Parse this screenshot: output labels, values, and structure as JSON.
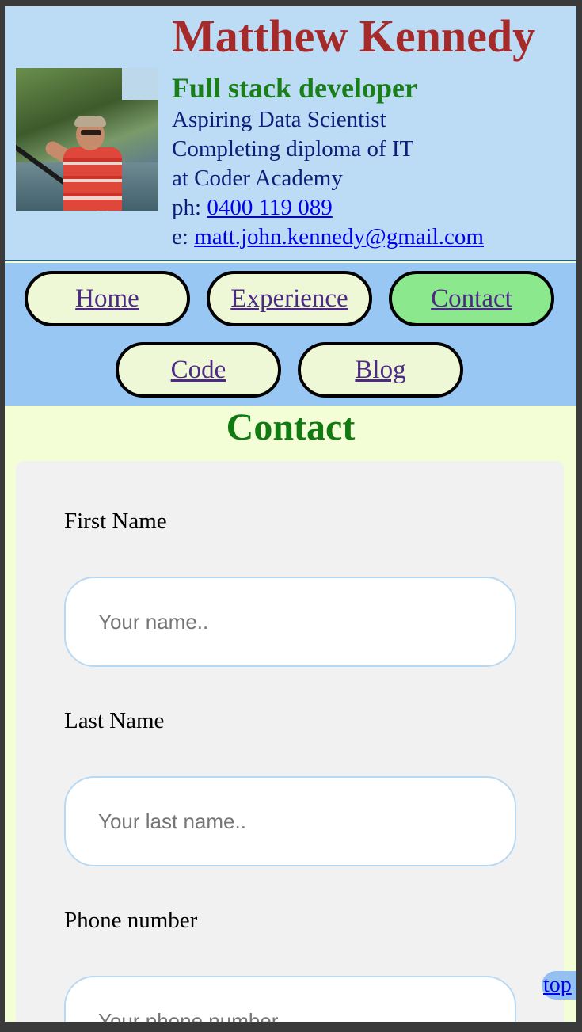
{
  "header": {
    "name": "Matthew Kennedy",
    "role": "Full stack developer",
    "lines": [
      "Aspiring Data Scientist",
      "Completing diploma of IT",
      "at Coder Academy"
    ],
    "phone_prefix": "ph: ",
    "phone": "0400 119 089",
    "email_prefix": "e: ",
    "email": "matt.john.kennedy@gmail.com"
  },
  "nav": {
    "items": [
      {
        "label": "Home",
        "active": false
      },
      {
        "label": "Experience",
        "active": false
      },
      {
        "label": "Contact",
        "active": true
      },
      {
        "label": "Code",
        "active": false
      },
      {
        "label": "Blog",
        "active": false
      }
    ]
  },
  "main": {
    "title": "Contact",
    "form": {
      "fields": [
        {
          "label": "First Name",
          "placeholder": "Your name.."
        },
        {
          "label": "Last Name",
          "placeholder": "Your last name.."
        },
        {
          "label": "Phone number",
          "placeholder": "Your phone number.."
        }
      ]
    }
  },
  "top_link": "top",
  "colors": {
    "header_bg": "#bcdcf6",
    "nav_bg": "#99c7f3",
    "page_bg": "#f3fdd6",
    "name": "#a52a2a",
    "role": "#1a7f1a",
    "active_nav": "#8ce88c"
  }
}
